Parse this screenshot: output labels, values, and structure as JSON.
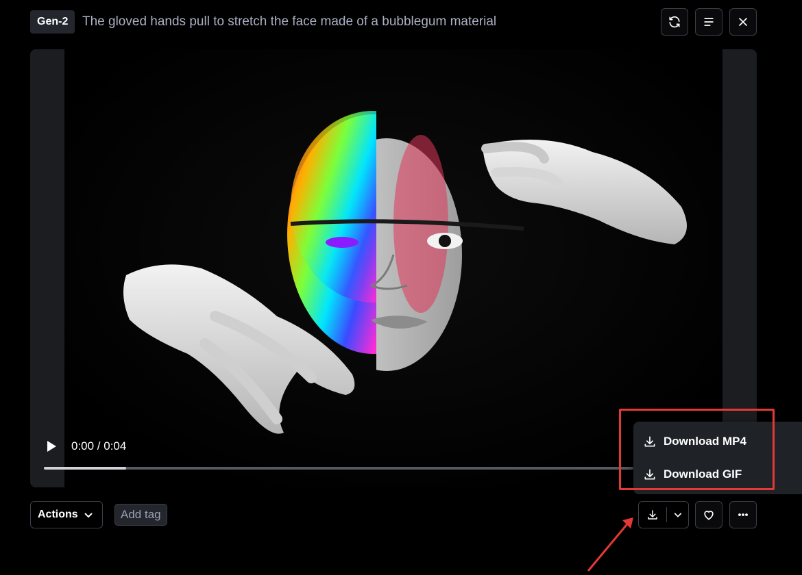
{
  "header": {
    "model_badge": "Gen-2",
    "prompt": "The gloved hands pull to stretch the face made of a bubblegum material",
    "buttons": {
      "regenerate_icon": "refresh-icon",
      "details_icon": "text-align-icon",
      "close_icon": "close-icon"
    }
  },
  "player": {
    "time": "0:00 / 0:04",
    "progress": 0.14
  },
  "download_menu": {
    "items": [
      {
        "label": "Download MP4",
        "icon": "download-icon"
      },
      {
        "label": "Download GIF",
        "icon": "download-icon"
      }
    ]
  },
  "toolbar": {
    "actions_label": "Actions",
    "add_tag_label": "Add tag"
  },
  "colors": {
    "background": "#000000",
    "surface": "#1b1d21",
    "border": "#3b3f47",
    "annotation": "#e53935"
  }
}
